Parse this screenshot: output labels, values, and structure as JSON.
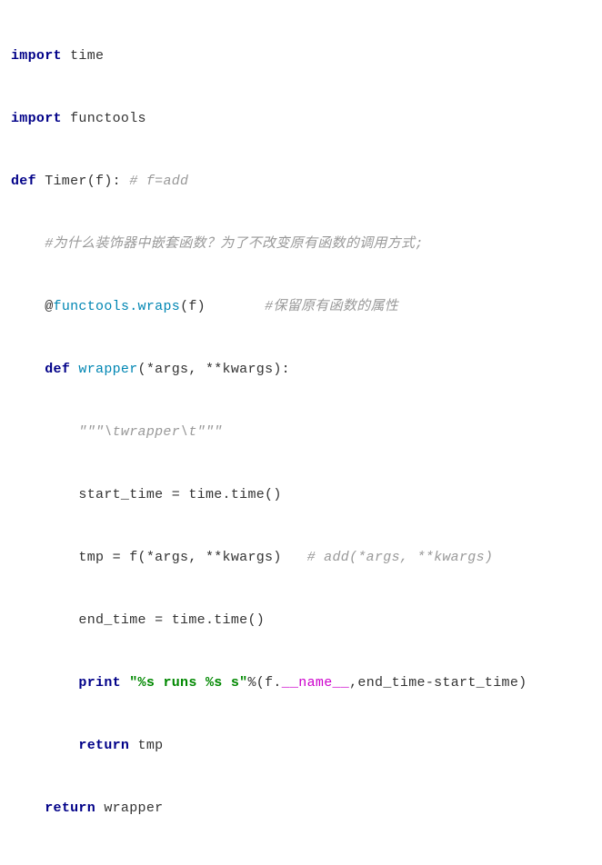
{
  "code": {
    "l1_kw": "import",
    "l1_mod": " time",
    "l2_kw": "import",
    "l2_mod": " functools",
    "l3_kw": "def",
    "l3_fn": " Timer(f): ",
    "l3_comment": "# f=add",
    "l4_comment": "#为什么装饰器中嵌套函数？为了不改变原有函数的调用方式;",
    "l5_at": "@",
    "l5_fn": "functools.wraps",
    "l5_args": "(f)       ",
    "l5_comment": "#保留原有函数的属性",
    "l6_kw": "def",
    "l6_fn": " wrapper",
    "l6_args": "(*args, **kwargs):",
    "l7_str": "\"\"\"\\twrapper\\t\"\"\"",
    "l8": "start_time = time.time()",
    "l9_a": "tmp = f(*args, **kwargs)   ",
    "l9_comment": "# add(*args, **kwargs)",
    "l10": "end_time = time.time()",
    "l11_kw": "print",
    "l11_str": " \"%s runs %s s\"",
    "l11_a": "%(f.",
    "l11_dunder": "__name__",
    "l11_b": ",end_time-start_time)",
    "l12_kw": "return",
    "l12_a": " tmp",
    "l13_kw": "return",
    "l13_a": " wrapper"
  }
}
